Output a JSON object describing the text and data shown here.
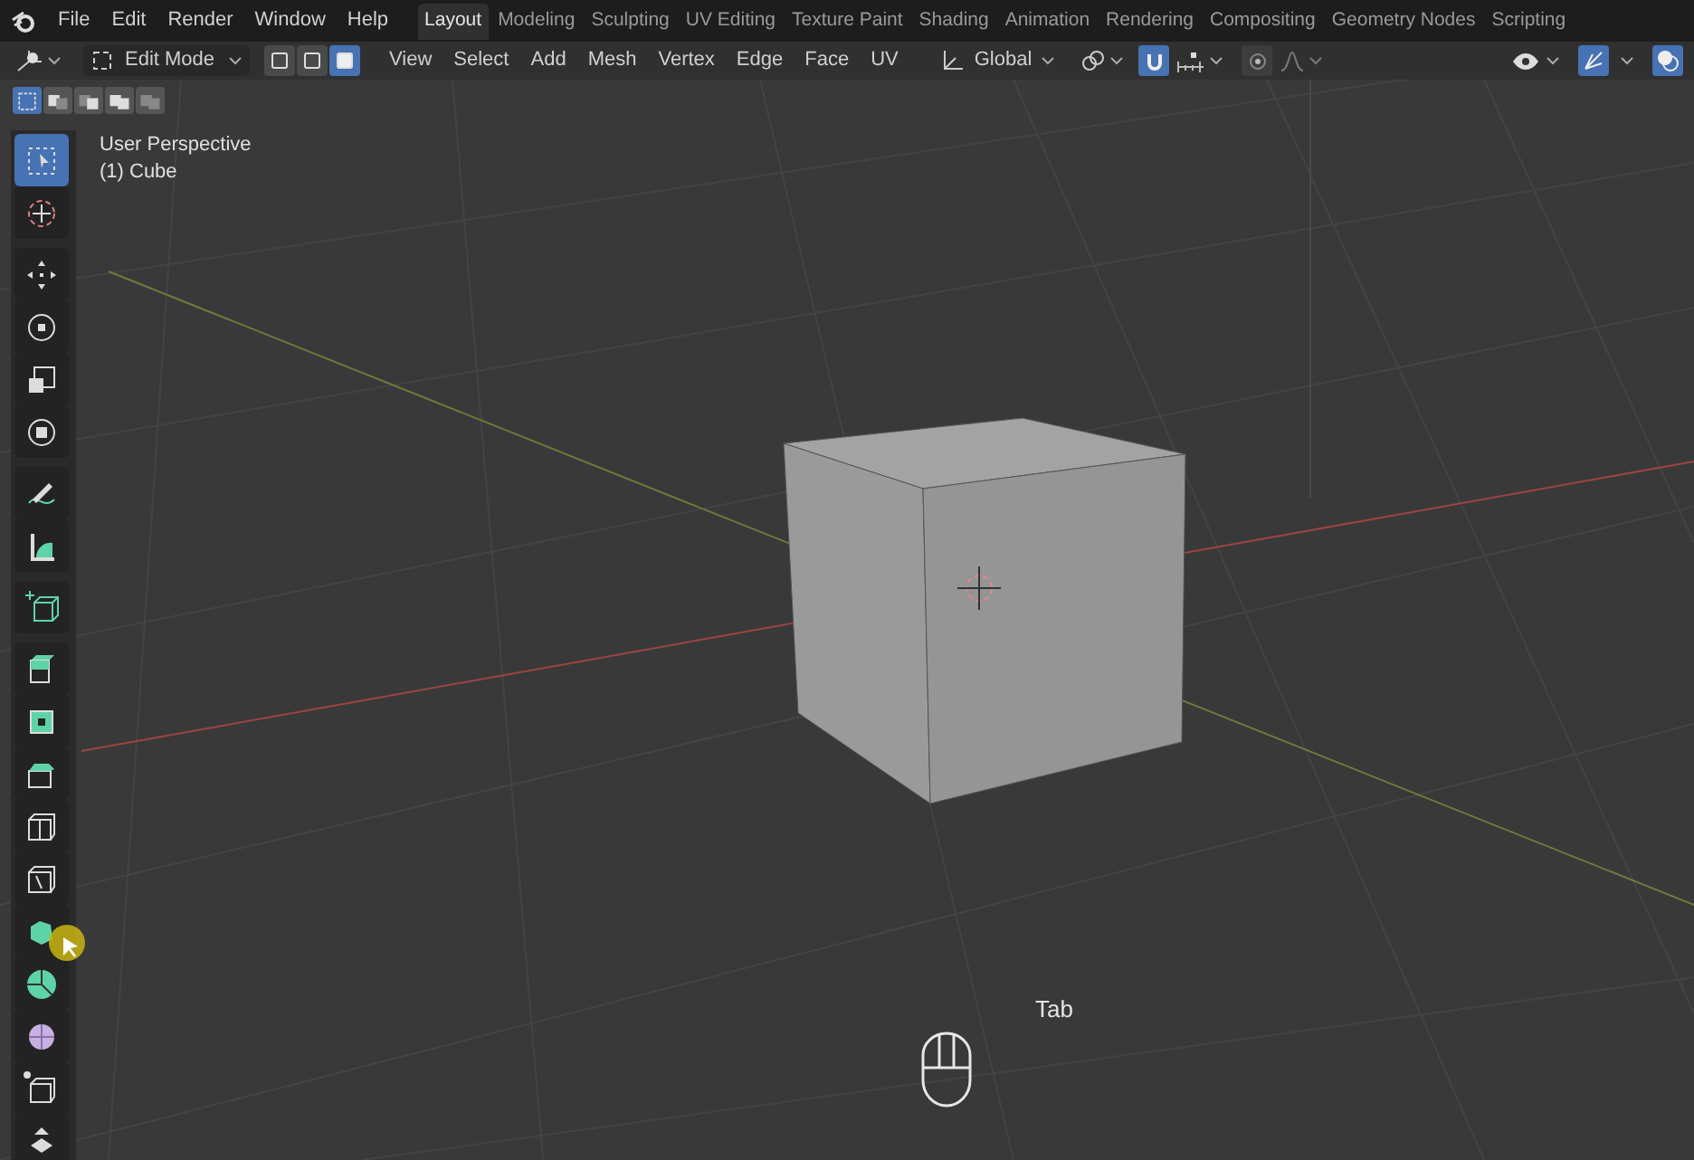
{
  "menu_bar": {
    "items": [
      "File",
      "Edit",
      "Render",
      "Window",
      "Help"
    ]
  },
  "workspace_tabs": [
    {
      "label": "Layout",
      "selected": true
    },
    {
      "label": "Modeling",
      "selected": false
    },
    {
      "label": "Sculpting",
      "selected": false
    },
    {
      "label": "UV Editing",
      "selected": false
    },
    {
      "label": "Texture Paint",
      "selected": false
    },
    {
      "label": "Shading",
      "selected": false
    },
    {
      "label": "Animation",
      "selected": false
    },
    {
      "label": "Rendering",
      "selected": false
    },
    {
      "label": "Compositing",
      "selected": false
    },
    {
      "label": "Geometry Nodes",
      "selected": false
    },
    {
      "label": "Scripting",
      "selected": false
    }
  ],
  "header": {
    "mode": "Edit Mode",
    "select_modes": [
      {
        "selected": false
      },
      {
        "selected": false
      },
      {
        "selected": true
      }
    ],
    "menus": [
      "View",
      "Select",
      "Add",
      "Mesh",
      "Vertex",
      "Edge",
      "Face",
      "UV"
    ],
    "orientation": "Global",
    "snap": {
      "on": true
    },
    "proportional_editing": {
      "on": false
    },
    "gizmos": {
      "on": true
    },
    "overlays": {
      "on": true
    }
  },
  "selection_ops": [
    {
      "selected": true
    },
    {
      "selected": false
    },
    {
      "selected": false
    },
    {
      "selected": false
    },
    {
      "selected": false
    }
  ],
  "viewport": {
    "view_name": "User Perspective",
    "object_name": "(1) Cube",
    "key_hint": "Tab"
  },
  "tools": [
    [
      {
        "selected": true
      },
      {
        "selected": false
      }
    ],
    [
      {
        "selected": false
      },
      {
        "selected": false
      },
      {
        "selected": false
      },
      {
        "selected": false
      }
    ],
    [
      {
        "selected": false
      },
      {
        "selected": false
      }
    ],
    [
      {
        "selected": false
      }
    ],
    [
      {
        "selected": false
      },
      {
        "selected": false
      },
      {
        "selected": false
      },
      {
        "selected": false
      },
      {
        "selected": false
      },
      {
        "selected": false
      },
      {
        "selected": false
      },
      {
        "selected": false
      },
      {
        "selected": false
      },
      {
        "selected": false
      }
    ]
  ]
}
